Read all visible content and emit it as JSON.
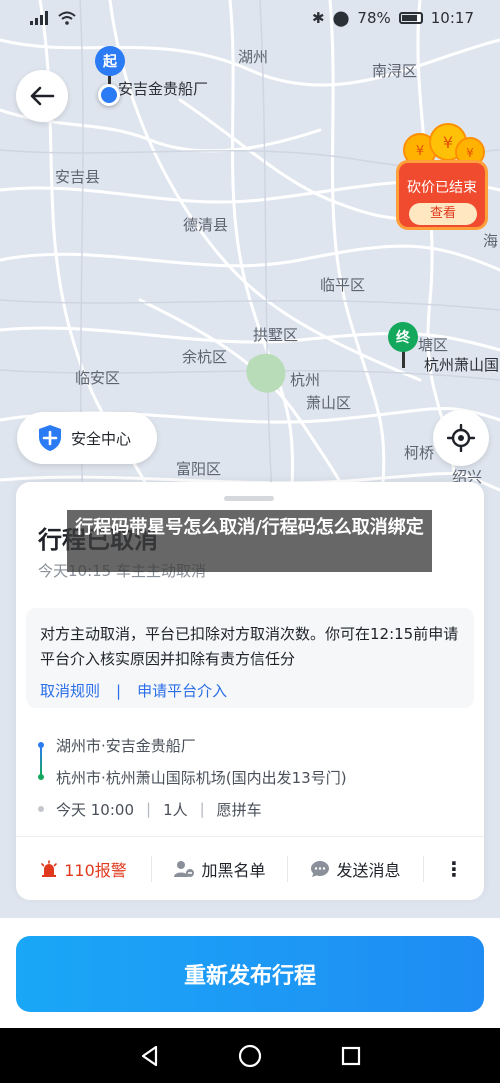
{
  "status_bar": {
    "signal": "signal-icon",
    "wifi": "wifi-icon",
    "battery_percent": "78%",
    "time": "10:17"
  },
  "map": {
    "start_marker": "起",
    "end_marker": "终",
    "start_label": "安吉金贵船厂",
    "end_label": "杭州萧山国",
    "places": {
      "huzhou": "湖州",
      "nanxun": "南浔区",
      "anji": "安吉县",
      "deqing": "德清县",
      "linping": "临平区",
      "gongshu": "拱墅区",
      "yuhang": "余杭区",
      "linan": "临安区",
      "hangzhou": "杭州",
      "xiaoshan": "萧山区",
      "fuyang": "富阳区",
      "kebang": "柯桥",
      "shaoxing": "绍兴",
      "hai": "海",
      "tangqi": "塘区"
    }
  },
  "promo": {
    "title": "砍价已结束",
    "button": "查看"
  },
  "safety_center": {
    "label": "安全中心"
  },
  "card": {
    "title": "行程已取消",
    "subtitle": "今天10:15 车主主动取消",
    "notice": "对方主动取消，平台已扣除对方取消次数。你可在12:15前申请平台介入核实原因并扣除有责方信任分",
    "link_rules": "取消规则",
    "link_sep": "|",
    "link_appeal": "申请平台介入",
    "route": {
      "from": "湖州市·安吉金贵船厂",
      "to": "杭州市·杭州萧山国际机场(国内出发13号门)",
      "time": "今天 10:00",
      "people": "1人",
      "type": "愿拼车",
      "sep": "|"
    },
    "actions": {
      "alarm": "110报警",
      "block": "加黑名单",
      "message": "发送消息",
      "more": "⋮"
    }
  },
  "banner": {
    "text": "行程码带星号怎么取消/行程码怎么取消绑定"
  },
  "bottom_button": "重新发布行程"
}
